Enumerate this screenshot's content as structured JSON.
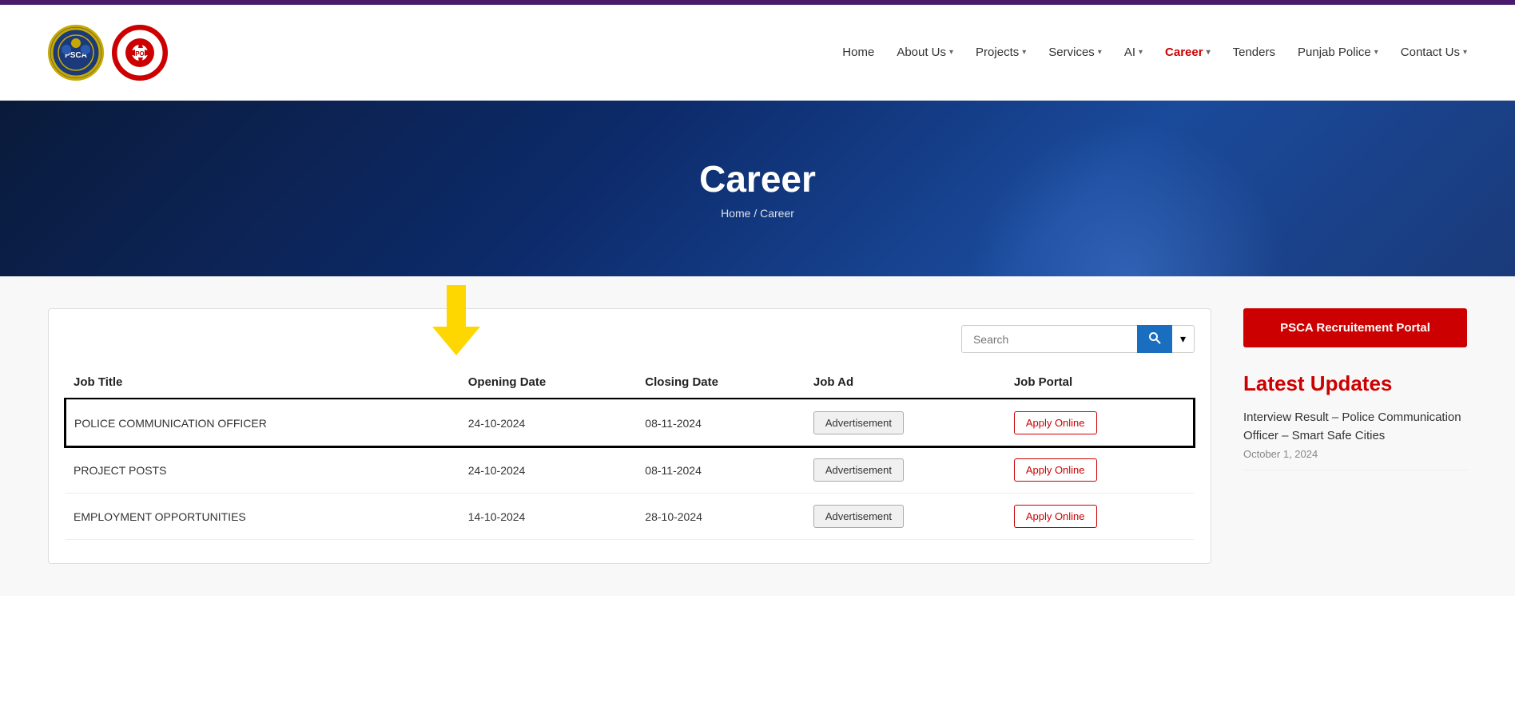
{
  "topbar": {},
  "header": {
    "logo_left_text": "PSCA",
    "logo_right_text": "PO",
    "nav": {
      "items": [
        {
          "label": "Home",
          "active": false,
          "hasDropdown": false
        },
        {
          "label": "About Us",
          "active": false,
          "hasDropdown": true
        },
        {
          "label": "Projects",
          "active": false,
          "hasDropdown": true
        },
        {
          "label": "Services",
          "active": false,
          "hasDropdown": true
        },
        {
          "label": "AI",
          "active": false,
          "hasDropdown": true
        },
        {
          "label": "Career",
          "active": true,
          "hasDropdown": true
        },
        {
          "label": "Tenders",
          "active": false,
          "hasDropdown": false
        },
        {
          "label": "Punjab Police",
          "active": false,
          "hasDropdown": true
        },
        {
          "label": "Contact Us",
          "active": false,
          "hasDropdown": true
        }
      ]
    }
  },
  "hero": {
    "title": "Career",
    "breadcrumb": "Home / Career"
  },
  "table": {
    "search_placeholder": "Search",
    "search_button_label": "🔍",
    "columns": [
      "Job Title",
      "Opening Date",
      "Closing Date",
      "Job Ad",
      "Job Portal"
    ],
    "rows": [
      {
        "title": "POLICE COMMUNICATION OFFICER",
        "opening_date": "24-10-2024",
        "closing_date": "08-11-2024",
        "ad_label": "Advertisement",
        "portal_label": "Apply Online",
        "highlighted": true
      },
      {
        "title": "PROJECT POSTS",
        "opening_date": "24-10-2024",
        "closing_date": "08-11-2024",
        "ad_label": "Advertisement",
        "portal_label": "Apply Online",
        "highlighted": false
      },
      {
        "title": "EMPLOYMENT OPPORTUNITIES",
        "opening_date": "14-10-2024",
        "closing_date": "28-10-2024",
        "ad_label": "Advertisement",
        "portal_label": "Apply Online",
        "highlighted": false
      }
    ]
  },
  "sidebar": {
    "psca_btn_label": "PSCA Recruitement Portal",
    "latest_updates_title": "Latest Updates",
    "updates": [
      {
        "title": "Interview Result – Police Communication Officer – Smart Safe Cities",
        "date": "October 1, 2024"
      }
    ]
  }
}
